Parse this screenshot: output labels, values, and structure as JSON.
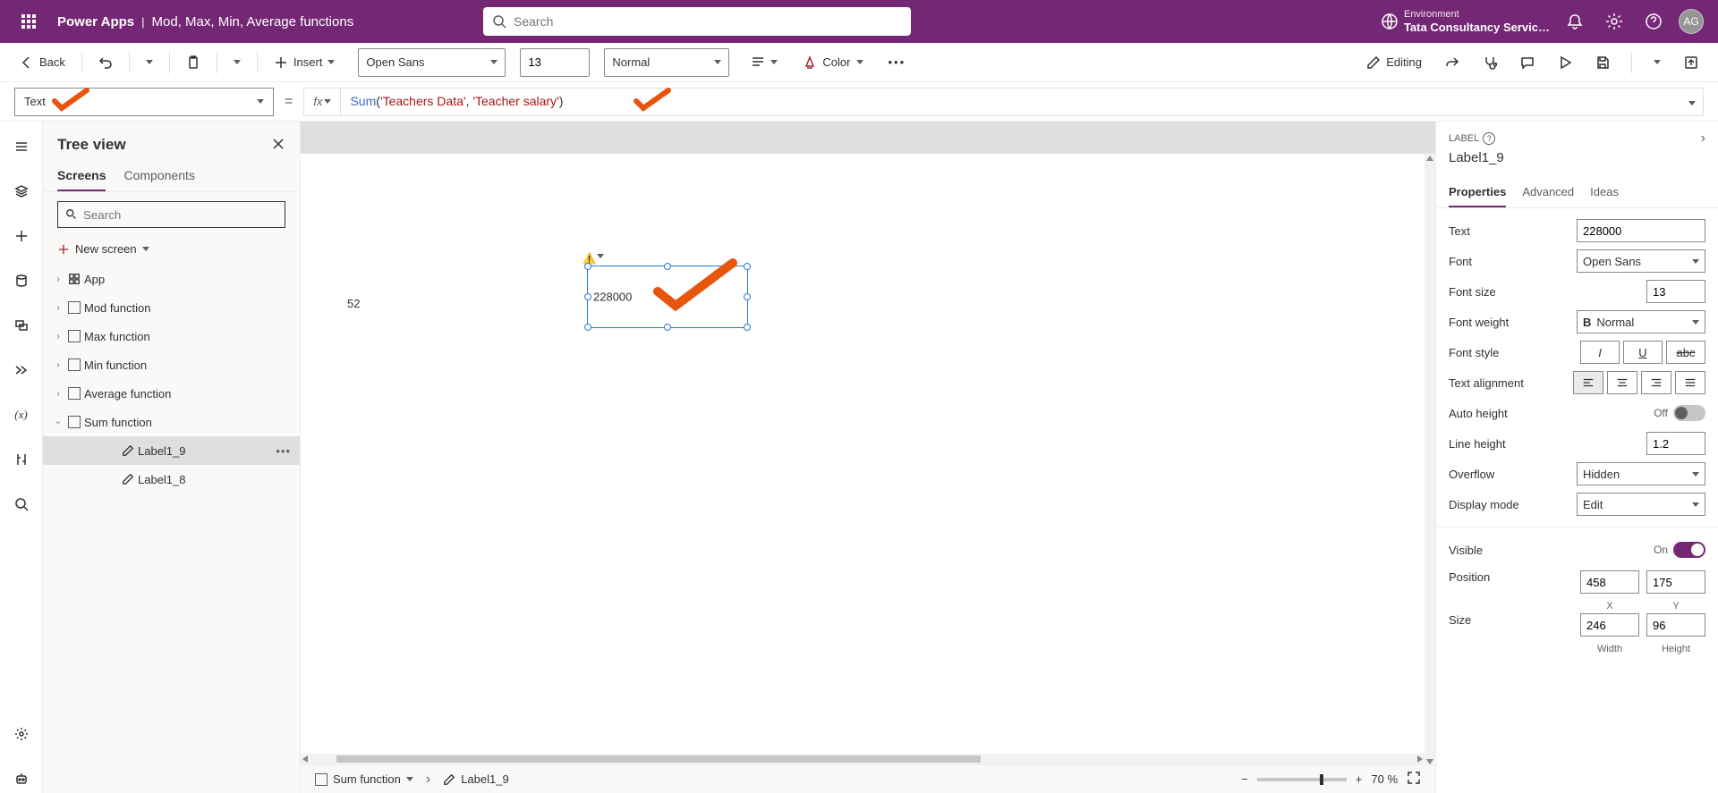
{
  "header": {
    "app": "Power Apps",
    "separator": "|",
    "title": "Mod, Max, Min, Average functions",
    "search_placeholder": "Search",
    "env_label": "Environment",
    "env_name": "Tata Consultancy Servic…",
    "avatar": "AG"
  },
  "cmdbar": {
    "back": "Back",
    "insert": "Insert",
    "font": "Open Sans",
    "font_size": "13",
    "font_weight": "Normal",
    "color": "Color",
    "editing": "Editing"
  },
  "formula": {
    "property": "Text",
    "equals": "=",
    "fx": "fx",
    "fn": "Sum",
    "open": "(",
    "arg1": "'Teachers Data'",
    "comma": ", ",
    "arg2": "'Teacher salary'",
    "close": ")"
  },
  "tree": {
    "title": "Tree view",
    "tabs": {
      "screens": "Screens",
      "components": "Components"
    },
    "search_placeholder": "Search",
    "new_screen": "New screen",
    "items": [
      {
        "label": "App",
        "type": "app"
      },
      {
        "label": "Mod function",
        "type": "screen"
      },
      {
        "label": "Max function",
        "type": "screen"
      },
      {
        "label": "Min function",
        "type": "screen"
      },
      {
        "label": "Average function",
        "type": "screen"
      },
      {
        "label": "Sum function",
        "type": "screen",
        "expanded": true
      },
      {
        "label": "Label1_9",
        "type": "label",
        "selected": true
      },
      {
        "label": "Label1_8",
        "type": "label"
      }
    ]
  },
  "canvas": {
    "label8_value": "52",
    "label9_value": "228000"
  },
  "status": {
    "crumb_screen": "Sum function",
    "crumb_control": "Label1_9",
    "zoom": "70",
    "zoom_unit": "%"
  },
  "props": {
    "type": "LABEL",
    "name": "Label1_9",
    "tabs": {
      "properties": "Properties",
      "advanced": "Advanced",
      "ideas": "Ideas"
    },
    "text_label": "Text",
    "text_value": "228000",
    "font_label": "Font",
    "font_value": "Open Sans",
    "fontsize_label": "Font size",
    "fontsize_value": "13",
    "fontweight_label": "Font weight",
    "fontweight_value": "Normal",
    "fontstyle_label": "Font style",
    "align_label": "Text alignment",
    "autoheight_label": "Auto height",
    "autoheight_value": "Off",
    "lineheight_label": "Line height",
    "lineheight_value": "1.2",
    "overflow_label": "Overflow",
    "overflow_value": "Hidden",
    "displaymode_label": "Display mode",
    "displaymode_value": "Edit",
    "visible_label": "Visible",
    "visible_value": "On",
    "position_label": "Position",
    "pos_x": "458",
    "pos_y": "175",
    "pos_xlabel": "X",
    "pos_ylabel": "Y",
    "size_label": "Size",
    "size_w": "246",
    "size_h": "96",
    "size_wlabel": "Width",
    "size_hlabel": "Height"
  }
}
